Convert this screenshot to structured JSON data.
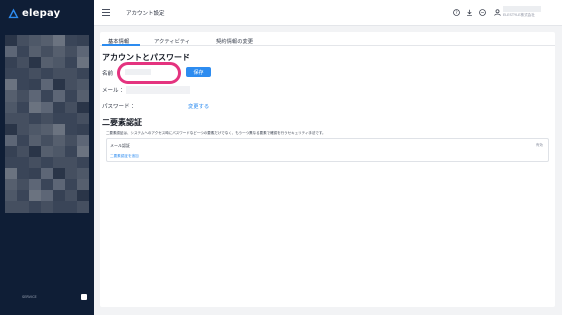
{
  "brand": {
    "name": "elepay",
    "accent": "#2d8cf0",
    "sidebar_bg": "#0f1e36",
    "highlight": "#e4337f"
  },
  "sidebar": {
    "account_rows": 16,
    "footer_text": "SERVICE",
    "footer_toggle_icon": "toggle-icon"
  },
  "header": {
    "menu_icon": "hamburger-icon",
    "title": "アカウント設定",
    "icons": [
      "help-icon",
      "download-icon",
      "chat-icon"
    ],
    "user_icon": "user-icon",
    "company": "ELESTYLE株式会社"
  },
  "tabs": [
    {
      "label": "基本情報",
      "active": true
    },
    {
      "label": "アクティビティ",
      "active": false
    },
    {
      "label": "契約情報の変更",
      "active": false
    }
  ],
  "account": {
    "section_title": "アカウントとパスワード",
    "name_label": "名前",
    "name_value": "",
    "save_label": "保存",
    "email_label": "メール ：",
    "password_label": "パスワード ：",
    "change_label": "変更する"
  },
  "two_factor": {
    "section_title": "二要素認証",
    "description": "二要素認証は、システムへのアクセス時にパスワードなど一つの要素だけでなく、もう一つ異なる要素で確認を行うセキュリティ手法です。",
    "email_auth_label": "メール認証",
    "email_auth_status": "有効",
    "add_link": "二要素認証を追加"
  }
}
